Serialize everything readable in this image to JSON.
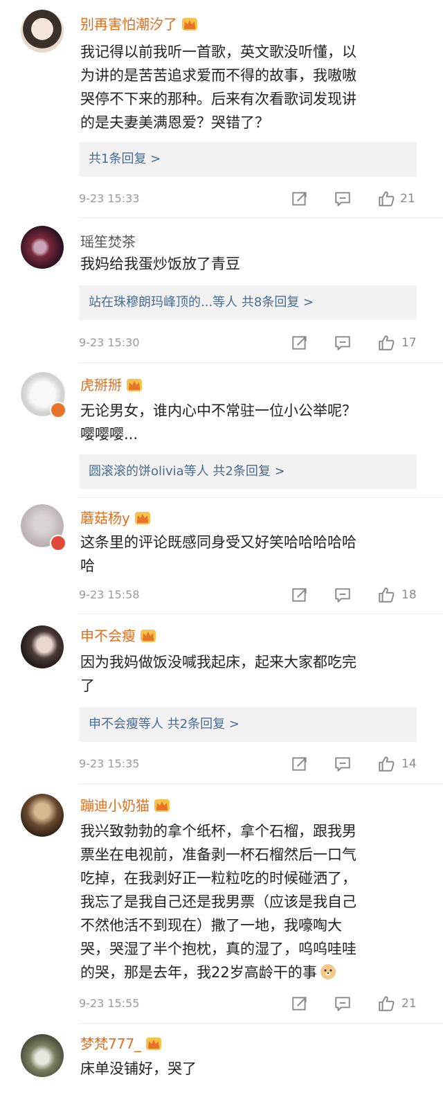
{
  "colors": {
    "vip_name": "#e46e1b",
    "plain_name": "#555555",
    "reply_link": "#4a6b92",
    "meta": "#9a9a9a"
  },
  "icons": {
    "vip": "crown-vip-icon",
    "repost": "repost-icon",
    "reply": "comment-icon",
    "like": "thumb-up-icon",
    "doge": "doge-emoji-icon"
  },
  "comments": [
    {
      "user": "别再害怕潮汐了",
      "body": [
        "我记得以前我听一首歌，英文歌没听懂，以",
        "为讲的是苦苦追求爱而不得的故事，我嗷嗷",
        "哭停不下来的那种。后来有次看歌词发现讲",
        "的是夫妻美满恩爱？哭错了？"
      ],
      "replies": "共1条回复 >",
      "time": "9-23 15:33",
      "likes": "21"
    },
    {
      "user": "瑶笙焚茶",
      "body": [
        "我妈给我蛋炒饭放了青豆"
      ],
      "replies": "站在珠穆朗玛峰顶的...等人  共8条回复 >",
      "time": "9-23 15:30",
      "likes": "17"
    },
    {
      "user": "虎掰掰",
      "body": [
        "无论男女，谁内心中不常驻一位小公举呢？",
        "嘤嘤嘤..."
      ],
      "replies": "圆滚滚的饼olivia等人  共2条回复 >"
    },
    {
      "user": "蘑菇杨y",
      "body": [
        "这条里的评论既感同身受又好笑哈哈哈哈哈",
        "哈"
      ],
      "time": "9-23 15:58",
      "likes": "18"
    },
    {
      "user": "申不会瘦",
      "body": [
        "因为我妈做饭没喊我起床，起来大家都吃完",
        "了"
      ],
      "replies": "申不会瘦等人  共2条回复 >",
      "time": "9-23 15:35",
      "likes": "14"
    },
    {
      "user": "蹦迪小奶猫",
      "body": [
        "我兴致勃勃的拿个纸杯，拿个石榴，跟我男",
        "票坐在电视前，准备剥一杯石榴然后一口气",
        "吃掉，在我剥好正一粒粒吃的时候碰洒了，",
        "我忘了是我自己还是我男票（应该是我自己",
        "不然他活不到现在）撒了一地，我嚎啕大",
        "哭，哭湿了半个抱枕，真的湿了，呜呜哇哇",
        "的哭，那是去年，我22岁高龄干的事"
      ],
      "time": "9-23 15:55",
      "likes": "21"
    },
    {
      "user": "梦梵777_",
      "body": [
        "床单没铺好，哭了"
      ]
    }
  ]
}
